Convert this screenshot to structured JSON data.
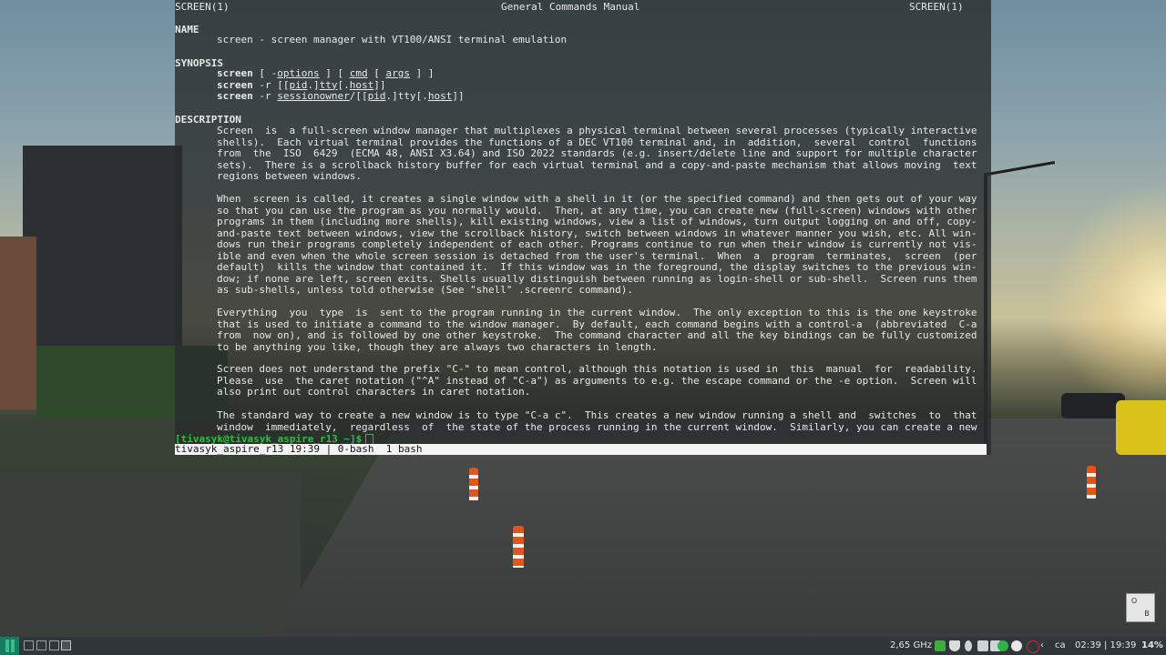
{
  "man": {
    "header_left": "SCREEN(1)",
    "header_center": "General Commands Manual",
    "header_right": "SCREEN(1)",
    "name_heading": "NAME",
    "name_line": "screen - screen manager with VT100/ANSI terminal emulation",
    "synopsis_heading": "SYNOPSIS",
    "synopsis": [
      {
        "cmd": "screen",
        "rest": " [ -",
        "opt": "options",
        "rest2": " ] [ ",
        "a": "cmd",
        "rest3": " [ ",
        "b": "args",
        "rest4": " ] ]"
      },
      {
        "cmd": "screen",
        "rest": " -r [[",
        "opt": "pid",
        "rest2": ".]",
        "a": "tty",
        "rest3": "[.",
        "b": "host",
        "rest4": "]]"
      },
      {
        "cmd": "screen",
        "rest": " -r ",
        "opt": "sessionowner",
        "rest2": "/[[",
        "a": "pid",
        "rest3": ".]tty[.",
        "b": "host",
        "rest4": "]]"
      }
    ],
    "description_heading": "DESCRIPTION",
    "paragraphs": [
      [
        "Screen  is  a full-screen window manager that multiplexes a physical terminal between several processes (typically interactive",
        "shells).  Each virtual terminal provides the functions of a DEC VT100 terminal and, in  addition,  several  control  functions",
        "from  the  ISO  6429  (ECMA 48, ANSI X3.64) and ISO 2022 standards (e.g. insert/delete line and support for multiple character",
        "sets).  There is a scrollback history buffer for each virtual terminal and a copy-and-paste mechanism that allows moving  text",
        "regions between windows."
      ],
      [
        "When  screen is called, it creates a single window with a shell in it (or the specified command) and then gets out of your way",
        "so that you can use the program as you normally would.  Then, at any time, you can create new (full-screen) windows with other",
        "programs in them (including more shells), kill existing windows, view a list of windows, turn output logging on and off, copy-",
        "and-paste text between windows, view the scrollback history, switch between windows in whatever manner you wish, etc. All win-",
        "dows run their programs completely independent of each other. Programs continue to run when their window is currently not vis-",
        "ible and even when the whole screen session is detached from the user's terminal.  When  a  program  terminates,  screen  (per",
        "default)  kills the window that contained it.  If this window was in the foreground, the display switches to the previous win-",
        "dow; if none are left, screen exits. Shells usually distinguish between running as login-shell or sub-shell.  Screen runs them",
        "as sub-shells, unless told otherwise (See \"shell\" .screenrc command)."
      ],
      [
        "Everything  you  type  is  sent to the program running in the current window.  The only exception to this is the one keystroke",
        "that is used to initiate a command to the window manager.  By default, each command begins with a control-a  (abbreviated  C-a",
        "from  now on), and is followed by one other keystroke.  The command character and all the key bindings can be fully customized",
        "to be anything you like, though they are always two characters in length."
      ],
      [
        "Screen does not understand the prefix \"C-\" to mean control, although this notation is used in  this  manual  for  readability.",
        "Please  use  the caret notation (\"^A\" instead of \"C-a\") as arguments to e.g. the escape command or the -e option.  Screen will",
        "also print out control characters in caret notation."
      ],
      [
        "The standard way to create a new window is to type \"C-a c\".  This creates a new window running a shell and  switches  to  that",
        "window  immediately,  regardless  of  the state of the process running in the current window.  Similarly, you can create a new"
      ]
    ]
  },
  "prompt": "[tivasyk@tivasyk_aspire_r13 ~]$",
  "statusbar": "tivasyk_aspire_r13 19:39 | 0-bash  1 bash",
  "panel": {
    "cpu": "2,65 GHz",
    "locale": "ca",
    "clock": "02:39 | 19:39",
    "battery": "14%"
  },
  "kbd_widget": {
    "top_left": "O",
    "bottom_right": "B"
  },
  "colors": {
    "prompt_green": "#25c43f",
    "panel_bg": "#31363b",
    "start_green": "#1a7a5f"
  }
}
